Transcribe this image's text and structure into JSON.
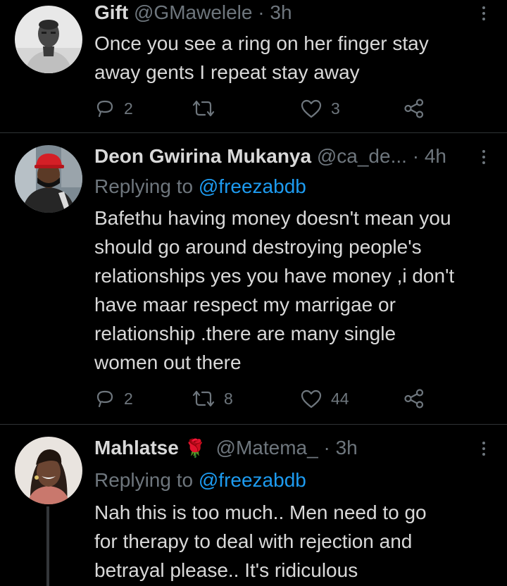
{
  "tweets": [
    {
      "name": "Gift",
      "handle": "@GMawelele",
      "time": "3h",
      "replying_prefix": "",
      "replying_to": "",
      "lines": [
        "Once you see a ring on her finger stay",
        "away gents I repeat stay away"
      ],
      "replies": "2",
      "retweets": "",
      "likes": "3"
    },
    {
      "name": "Deon Gwirina Mukanya",
      "handle": "@ca_de...",
      "time": "4h",
      "replying_prefix": "Replying to",
      "replying_to": "@freezabdb",
      "lines": [
        "Bafethu having money doesn't mean you",
        "should go around  destroying people's",
        "relationships yes you have money ,i don't",
        "have maar respect my marrigae or",
        "relationship .there are many single",
        "women out there"
      ],
      "replies": "2",
      "retweets": "8",
      "likes": "44"
    },
    {
      "name": "Mahlatse",
      "emoji": "🌹",
      "handle": "@Matema_",
      "time": "3h",
      "replying_prefix": "Replying to",
      "replying_to": "@freezabdb",
      "lines": [
        "Nah this is too much.. Men need to go",
        "for therapy to deal with rejection and",
        "betrayal please.. It's ridiculous"
      ]
    }
  ],
  "separator": "·",
  "icons": [
    "reply-icon",
    "retweet-icon",
    "like-icon",
    "share-icon",
    "more-icon"
  ],
  "colors": {
    "background": "#000000",
    "text": "#d9d9d9",
    "muted": "#6e767d",
    "link": "#1d9bf0",
    "divider": "#2f3336"
  }
}
